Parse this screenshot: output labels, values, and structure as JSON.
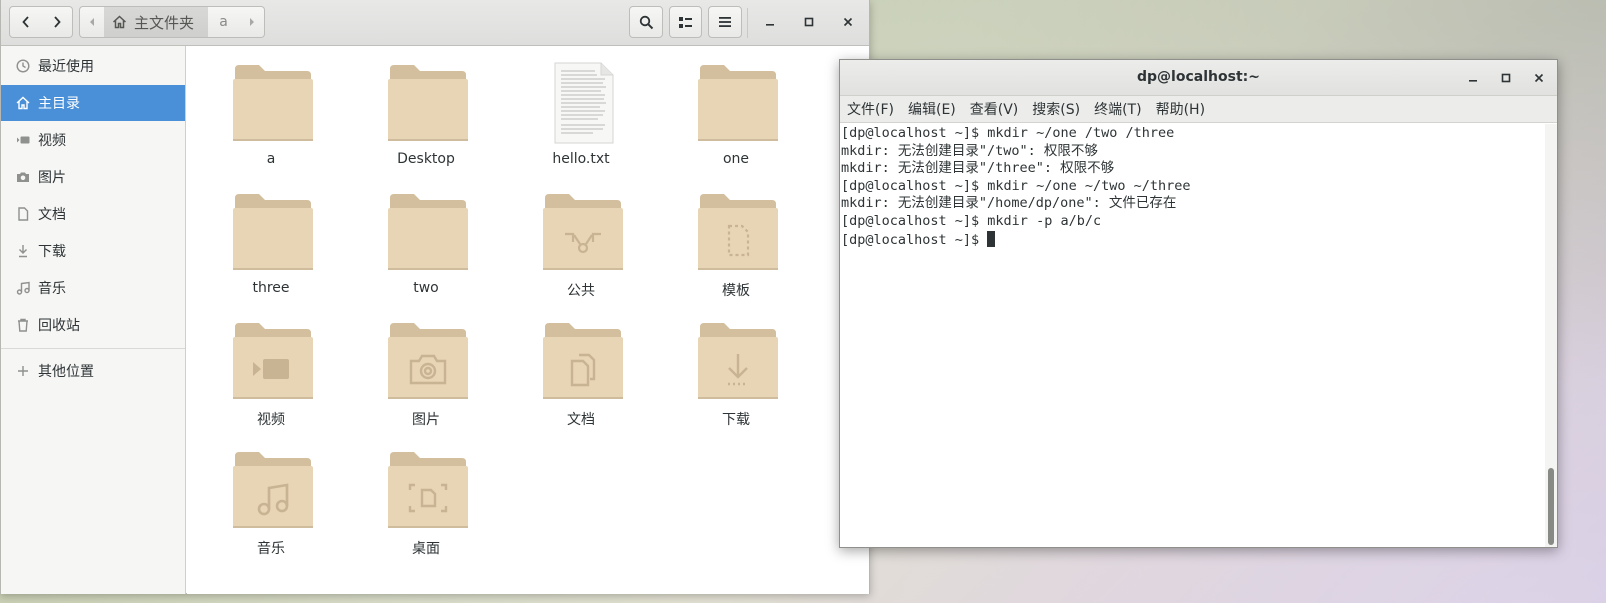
{
  "file_manager": {
    "toolbar": {
      "path_home_label": "主文件夹",
      "path_current_label": "a"
    },
    "sidebar": {
      "items": [
        {
          "label": "最近使用",
          "icon": "recent-icon"
        },
        {
          "label": "主目录",
          "icon": "home-icon",
          "active": true
        },
        {
          "label": "视频",
          "icon": "video-icon"
        },
        {
          "label": "图片",
          "icon": "camera-icon"
        },
        {
          "label": "文档",
          "icon": "document-icon"
        },
        {
          "label": "下载",
          "icon": "download-icon"
        },
        {
          "label": "音乐",
          "icon": "music-icon"
        },
        {
          "label": "回收站",
          "icon": "trash-icon"
        },
        {
          "label": "其他位置",
          "icon": "plus-icon"
        }
      ]
    },
    "files": [
      {
        "name": "a",
        "type": "folder",
        "emblem": ""
      },
      {
        "name": "Desktop",
        "type": "folder",
        "emblem": ""
      },
      {
        "name": "hello.txt",
        "type": "text-file",
        "emblem": ""
      },
      {
        "name": "one",
        "type": "folder",
        "emblem": ""
      },
      {
        "name": "three",
        "type": "folder",
        "emblem": ""
      },
      {
        "name": "two",
        "type": "folder",
        "emblem": ""
      },
      {
        "name": "公共",
        "type": "folder",
        "emblem": "share"
      },
      {
        "name": "模板",
        "type": "folder",
        "emblem": "template"
      },
      {
        "name": "视频",
        "type": "folder",
        "emblem": "video"
      },
      {
        "name": "图片",
        "type": "folder",
        "emblem": "camera"
      },
      {
        "name": "文档",
        "type": "folder",
        "emblem": "document"
      },
      {
        "name": "下载",
        "type": "folder",
        "emblem": "download"
      },
      {
        "name": "音乐",
        "type": "folder",
        "emblem": "music"
      },
      {
        "name": "桌面",
        "type": "folder",
        "emblem": "desktop"
      }
    ]
  },
  "terminal": {
    "title": "dp@localhost:~",
    "menu": [
      "文件(F)",
      "编辑(E)",
      "查看(V)",
      "搜索(S)",
      "终端(T)",
      "帮助(H)"
    ],
    "lines": [
      "[dp@localhost ~]$ mkdir ~/one /two /three",
      "mkdir: 无法创建目录\"/two\": 权限不够",
      "mkdir: 无法创建目录\"/three\": 权限不够",
      "[dp@localhost ~]$ mkdir ~/one ~/two ~/three",
      "mkdir: 无法创建目录\"/home/dp/one\": 文件已存在",
      "[dp@localhost ~]$ mkdir -p a/b/c",
      "[dp@localhost ~]$ "
    ]
  },
  "colors": {
    "accent": "#4a90d9",
    "folder_body": "#e8d5b5",
    "folder_tab": "#d3bf9d",
    "folder_emblem": "#c8b393"
  }
}
